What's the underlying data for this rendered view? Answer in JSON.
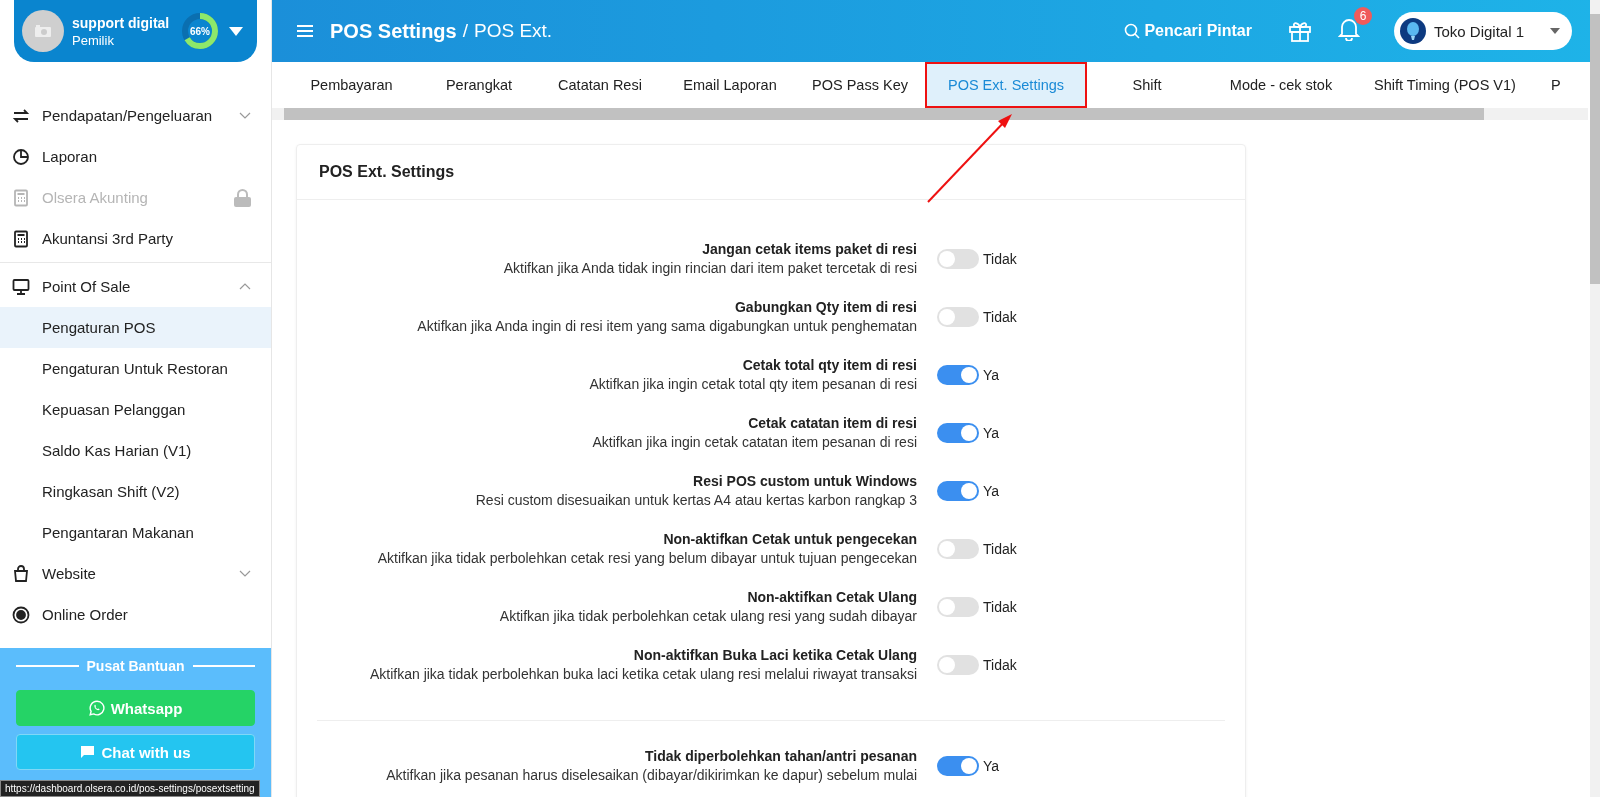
{
  "profile": {
    "name": "support digital",
    "role": "Pemilik",
    "progress": "66%",
    "level": 0.66
  },
  "menu": [
    {
      "label": "Pendapatan/Pengeluaran",
      "expanded": false
    },
    {
      "label": "Laporan"
    },
    {
      "label": "Olsera Akunting",
      "disabled": true
    },
    {
      "label": "Akuntansi 3rd Party"
    },
    {
      "label": "Point Of Sale",
      "expanded": true,
      "divider_before": true,
      "children": [
        {
          "label": "Pengaturan POS",
          "selected": true
        },
        {
          "label": "Pengaturan Untuk Restoran",
          "selected": false
        },
        {
          "label": "Kepuasan Pelanggan",
          "selected": false
        },
        {
          "label": "Saldo Kas Harian (V1)",
          "selected": false
        },
        {
          "label": "Ringkasan Shift (V2)",
          "selected": false
        },
        {
          "label": "Pengantaran Makanan",
          "selected": false
        }
      ]
    },
    {
      "label": "Website",
      "expanded": false
    },
    {
      "label": "Online Order"
    }
  ],
  "help": {
    "title": "Pusat Bantuan",
    "buttons": [
      "Whatsapp",
      "Chat with us"
    ]
  },
  "status_url": "https://dashboard.olsera.co.id/pos-settings/posextsetting",
  "header": {
    "title": "POS Settings",
    "separator": "/",
    "subtitle": "POS Ext.",
    "search": "Pencari Pintar",
    "notifications": "6",
    "store": "Toko Digital 1"
  },
  "tabs": [
    {
      "label": "Pembayaran",
      "selected": false
    },
    {
      "label": "Perangkat",
      "selected": false
    },
    {
      "label": "Catatan Resi",
      "selected": false
    },
    {
      "label": "Email Laporan",
      "selected": false
    },
    {
      "label": "POS Pass Key",
      "selected": false
    },
    {
      "label": "POS Ext. Settings",
      "selected": true
    },
    {
      "label": "Shift",
      "selected": false
    },
    {
      "label": "Mode - cek stok",
      "selected": false
    },
    {
      "label": "Shift Timing (POS V1)",
      "selected": false
    },
    {
      "label": "P",
      "selected": false
    }
  ],
  "card": {
    "title": "POS Ext. Settings",
    "groups": [
      [
        {
          "title": "Jangan cetak items paket di resi",
          "description": "Aktifkan jika Anda tidak ingin rincian dari item paket tercetak di resi",
          "on": false,
          "state": "Tidak"
        },
        {
          "title": "Gabungkan Qty item di resi",
          "description": "Aktifkan jika Anda ingin di resi item yang sama digabungkan untuk penghematan",
          "on": false,
          "state": "Tidak"
        },
        {
          "title": "Cetak total qty item di resi",
          "description": "Aktifkan jika ingin cetak total qty item pesanan di resi",
          "on": true,
          "state": "Ya"
        },
        {
          "title": "Cetak catatan item di resi",
          "description": "Aktifkan jika ingin cetak catatan item pesanan di resi",
          "on": true,
          "state": "Ya"
        },
        {
          "title": "Resi POS custom untuk Windows",
          "description": "Resi custom disesuaikan untuk kertas A4 atau kertas karbon rangkap 3",
          "on": true,
          "state": "Ya"
        },
        {
          "title": "Non-aktifkan Cetak untuk pengecekan",
          "description": "Aktifkan jika tidak perbolehkan cetak resi yang belum dibayar untuk tujuan pengecekan",
          "on": false,
          "state": "Tidak"
        },
        {
          "title": "Non-aktifkan Cetak Ulang",
          "description": "Aktifkan jika tidak perbolehkan cetak ulang resi yang sudah dibayar",
          "on": false,
          "state": "Tidak"
        },
        {
          "title": "Non-aktifkan Buka Laci ketika Cetak Ulang",
          "description": "Aktifkan jika tidak perbolehkan buka laci ketika cetak ulang resi melalui riwayat transaksi",
          "on": false,
          "state": "Tidak"
        }
      ],
      [
        {
          "title": "Tidak diperbolehkan tahan/antri pesanan",
          "description": "Aktifkan jika pesanan harus diselesaikan (dibayar/dikirimkan ke dapur) sebelum mulai",
          "on": true,
          "state": "Ya"
        }
      ]
    ]
  }
}
